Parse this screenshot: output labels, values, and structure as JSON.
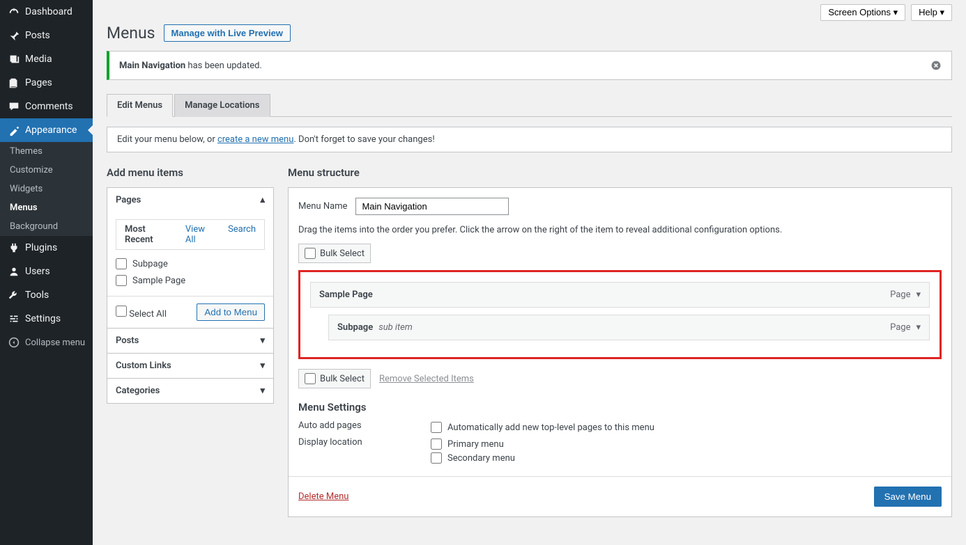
{
  "topbar": {
    "screen_options": "Screen Options ▾",
    "help": "Help ▾"
  },
  "sidebar": {
    "items": [
      {
        "label": "Dashboard",
        "icon": "dashboard"
      },
      {
        "label": "Posts",
        "icon": "pin"
      },
      {
        "label": "Media",
        "icon": "media"
      },
      {
        "label": "Pages",
        "icon": "pages"
      },
      {
        "label": "Comments",
        "icon": "comments"
      },
      {
        "label": "Appearance",
        "icon": "brush",
        "active": true
      },
      {
        "label": "Plugins",
        "icon": "plugin"
      },
      {
        "label": "Users",
        "icon": "users"
      },
      {
        "label": "Tools",
        "icon": "tools"
      },
      {
        "label": "Settings",
        "icon": "settings"
      }
    ],
    "submenu": [
      {
        "label": "Themes"
      },
      {
        "label": "Customize"
      },
      {
        "label": "Widgets"
      },
      {
        "label": "Menus",
        "current": true
      },
      {
        "label": "Background"
      }
    ],
    "collapse": "Collapse menu"
  },
  "page": {
    "title": "Menus",
    "live_preview": "Manage with Live Preview"
  },
  "notice": {
    "strong": "Main Navigation",
    "rest": " has been updated."
  },
  "tabs": {
    "edit": "Edit Menus",
    "locations": "Manage Locations"
  },
  "helpbox": {
    "before": "Edit your menu below, or ",
    "link": "create a new menu",
    "after": ". Don't forget to save your changes!"
  },
  "left": {
    "heading": "Add menu items",
    "pages": {
      "title": "Pages",
      "tabs": {
        "recent": "Most Recent",
        "view_all": "View All",
        "search": "Search"
      },
      "items": [
        "Subpage",
        "Sample Page"
      ],
      "select_all": "Select All",
      "add_btn": "Add to Menu"
    },
    "other": [
      "Posts",
      "Custom Links",
      "Categories"
    ]
  },
  "right": {
    "heading": "Menu structure",
    "name_label": "Menu Name",
    "name_value": "Main Navigation",
    "hint": "Drag the items into the order you prefer. Click the arrow on the right of the item to reveal additional configuration options.",
    "bulk_select": "Bulk Select",
    "remove_selected": "Remove Selected Items",
    "items": [
      {
        "title": "Sample Page",
        "type": "Page",
        "sub": false
      },
      {
        "title": "Subpage",
        "type": "Page",
        "sub": true,
        "subtxt": "sub item"
      }
    ],
    "settings": {
      "heading": "Menu Settings",
      "auto_label": "Auto add pages",
      "auto_opt": "Automatically add new top-level pages to this menu",
      "loc_label": "Display location",
      "loc_opts": [
        "Primary menu",
        "Secondary menu"
      ]
    },
    "delete": "Delete Menu",
    "save": "Save Menu"
  }
}
